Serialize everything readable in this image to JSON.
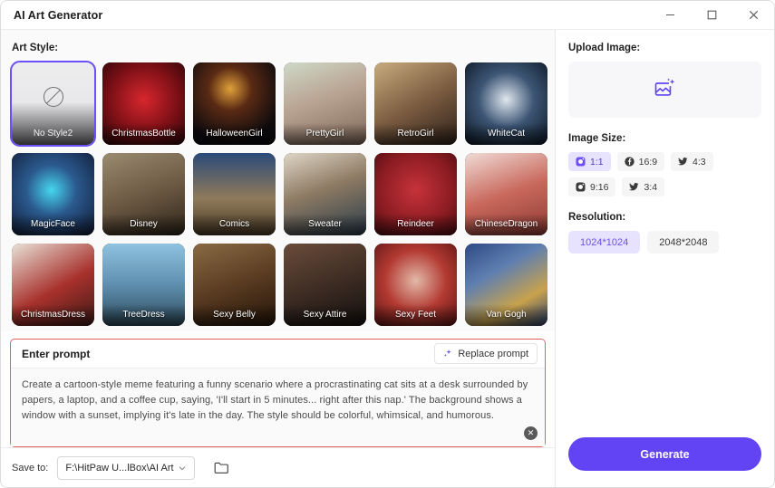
{
  "window": {
    "title": "AI Art Generator",
    "minimize_label": "Minimize",
    "maximize_label": "Maximize",
    "close_label": "Close"
  },
  "art_style": {
    "label": "Art Style:",
    "items": [
      {
        "label": "No Style2",
        "icon": "no-style-icon",
        "selected": true,
        "thumb": "none"
      },
      {
        "label": "ChristmasBottle",
        "selected": false,
        "thumb": "christmas-bottle"
      },
      {
        "label": "HalloweenGirl",
        "selected": false,
        "thumb": "halloween-girl"
      },
      {
        "label": "PrettyGirl",
        "selected": false,
        "thumb": "pretty-girl"
      },
      {
        "label": "RetroGirl",
        "selected": false,
        "thumb": "retro-girl"
      },
      {
        "label": "WhiteCat",
        "selected": false,
        "thumb": "white-cat"
      },
      {
        "label": "MagicFace",
        "selected": false,
        "thumb": "magic-face"
      },
      {
        "label": "Disney",
        "selected": false,
        "thumb": "disney"
      },
      {
        "label": "Comics",
        "selected": false,
        "thumb": "comics"
      },
      {
        "label": "Sweater",
        "selected": false,
        "thumb": "sweater"
      },
      {
        "label": "Reindeer",
        "selected": false,
        "thumb": "reindeer"
      },
      {
        "label": "ChineseDragon",
        "selected": false,
        "thumb": "chinese-dragon"
      },
      {
        "label": "ChristmasDress",
        "selected": false,
        "thumb": "christmas-dress"
      },
      {
        "label": "TreeDress",
        "selected": false,
        "thumb": "tree-dress"
      },
      {
        "label": "Sexy Belly",
        "selected": false,
        "thumb": "sexy-belly"
      },
      {
        "label": "Sexy Attire",
        "selected": false,
        "thumb": "sexy-attire"
      },
      {
        "label": "Sexy Feet",
        "selected": false,
        "thumb": "sexy-feet"
      },
      {
        "label": "Van Gogh",
        "selected": false,
        "thumb": "van-gogh"
      }
    ]
  },
  "prompt": {
    "title": "Enter prompt",
    "replace_label": "Replace prompt",
    "text": "Create a cartoon-style meme featuring a funny scenario where a procrastinating cat sits at a desk surrounded by papers, a laptop, and a coffee cup, saying, 'I'll start in 5 minutes... right after this nap.' The background shows a window with a sunset, implying it's late in the day. The style should be colorful, whimsical, and humorous.",
    "clear_label": "✕"
  },
  "save": {
    "label": "Save to:",
    "path": "F:\\HitPaw U...lBox\\AI Art",
    "browse_label": "Browse folder"
  },
  "upload": {
    "label": "Upload Image:",
    "icon": "image-sparkle-icon"
  },
  "image_size": {
    "label": "Image Size:",
    "options": [
      {
        "ratio": "1:1",
        "icon": "instagram-icon",
        "active": true
      },
      {
        "ratio": "16:9",
        "icon": "facebook-icon",
        "active": false
      },
      {
        "ratio": "4:3",
        "icon": "twitter-icon",
        "active": false
      },
      {
        "ratio": "9:16",
        "icon": "instagram-icon",
        "active": false
      },
      {
        "ratio": "3:4",
        "icon": "twitter-icon",
        "active": false
      }
    ]
  },
  "resolution": {
    "label": "Resolution:",
    "options": [
      {
        "value": "1024*1024",
        "active": true
      },
      {
        "value": "2048*2048",
        "active": false
      }
    ]
  },
  "actions": {
    "generate_label": "Generate"
  },
  "colors": {
    "accent": "#6344f5",
    "accent_soft": "#e7e2fd",
    "prompt_border": "#e06262"
  }
}
